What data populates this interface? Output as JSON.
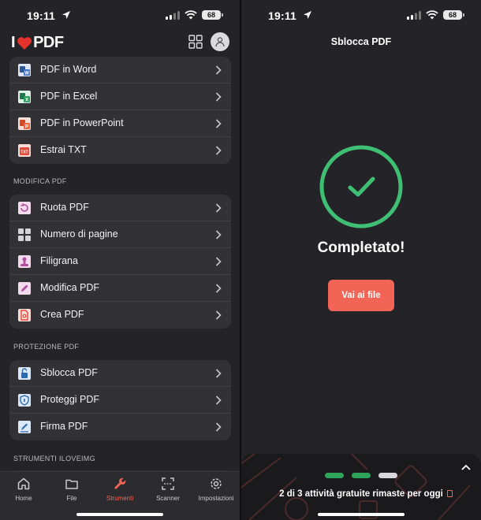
{
  "left": {
    "status": {
      "time": "19:11",
      "battery": "68"
    },
    "brand": {
      "prefix": "I",
      "name": "PDF",
      "color": "#e5322d"
    },
    "sections": [
      {
        "title": "",
        "items": [
          {
            "label": "PDF in Word",
            "icon": "word-icon",
            "color": "#2b5797"
          },
          {
            "label": "PDF in Excel",
            "icon": "excel-icon",
            "color": "#1f7a4a"
          },
          {
            "label": "PDF in PowerPoint",
            "icon": "powerpoint-icon",
            "color": "#d24726"
          },
          {
            "label": "Estrai TXT",
            "icon": "txt-icon",
            "color": "#e04a3a"
          }
        ]
      },
      {
        "title": "MODIFICA PDF",
        "items": [
          {
            "label": "Ruota PDF",
            "icon": "rotate-icon",
            "color": "#b44fa0"
          },
          {
            "label": "Numero di pagine",
            "icon": "page-numbers-icon",
            "color": "#9b9ba0"
          },
          {
            "label": "Filigrana",
            "icon": "watermark-icon",
            "color": "#b44fa0"
          },
          {
            "label": "Modifica PDF",
            "icon": "edit-icon",
            "color": "#b44fa0"
          },
          {
            "label": "Crea PDF",
            "icon": "create-pdf-icon",
            "color": "#e04a3a"
          }
        ]
      },
      {
        "title": "PROTEZIONE PDF",
        "items": [
          {
            "label": "Sblocca PDF",
            "icon": "unlock-icon",
            "color": "#2b6cb0"
          },
          {
            "label": "Proteggi PDF",
            "icon": "protect-icon",
            "color": "#2b6cb0"
          },
          {
            "label": "Firma PDF",
            "icon": "sign-icon",
            "color": "#2b6cb0"
          }
        ]
      },
      {
        "title": "STRUMENTI ILOVEIMG",
        "items": []
      }
    ],
    "tabs": [
      {
        "label": "Home",
        "icon": "home-icon",
        "active": false
      },
      {
        "label": "File",
        "icon": "folder-icon",
        "active": false
      },
      {
        "label": "Strumenti",
        "icon": "wrench-icon",
        "active": true
      },
      {
        "label": "Scanner",
        "icon": "scanner-icon",
        "active": false
      },
      {
        "label": "Impostazioni",
        "icon": "settings-gear-icon",
        "active": false
      }
    ],
    "accent": "#f26455"
  },
  "right": {
    "status": {
      "time": "19:11",
      "battery": "68"
    },
    "title": "Sblocca PDF",
    "done": "Completato!",
    "button": "Vai ai file",
    "success_color": "#3fbf74",
    "promo": {
      "text": "2 di 3 attività gratuite rimaste per oggi",
      "used": 2,
      "total": 3,
      "used_color": "#2ea35a",
      "free_color": "#d8d8dc"
    }
  }
}
